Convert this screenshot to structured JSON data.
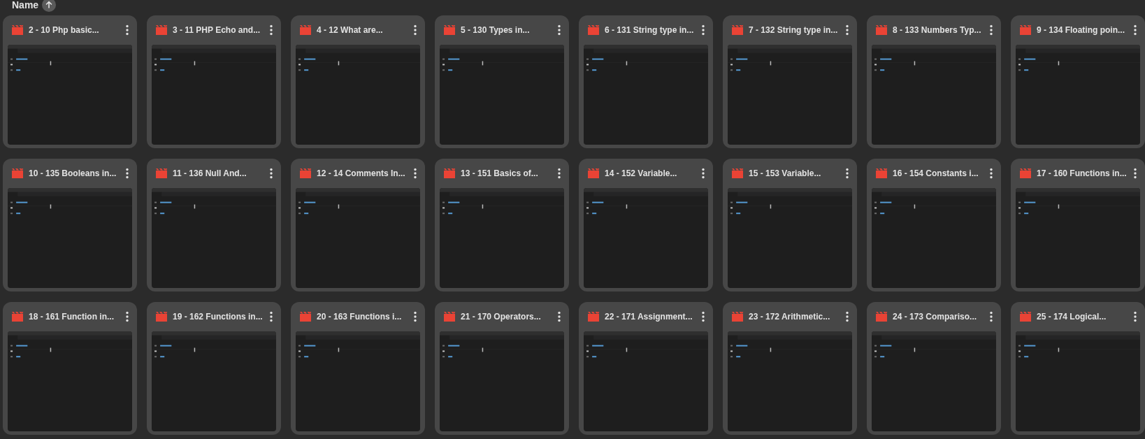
{
  "sort_header": {
    "label": "Name",
    "ascending": true
  },
  "files": [
    {
      "title": "2 - 10 Php basic...",
      "kind": "video"
    },
    {
      "title": "3 - 11 PHP Echo and...",
      "kind": "video"
    },
    {
      "title": "4 - 12 What are...",
      "kind": "video"
    },
    {
      "title": "5 - 130 Types in...",
      "kind": "video"
    },
    {
      "title": "6 - 131 String type in...",
      "kind": "video"
    },
    {
      "title": "7 - 132 String type in...",
      "kind": "video"
    },
    {
      "title": "8 - 133 Numbers Typ...",
      "kind": "video"
    },
    {
      "title": "9 - 134 Floating poin...",
      "kind": "video"
    },
    {
      "title": "10 - 135 Booleans in...",
      "kind": "video"
    },
    {
      "title": "11 - 136 Null And...",
      "kind": "video"
    },
    {
      "title": "12 - 14 Comments In...",
      "kind": "video"
    },
    {
      "title": "13 - 151 Basics of...",
      "kind": "video"
    },
    {
      "title": "14 - 152 Variable...",
      "kind": "video"
    },
    {
      "title": "15 - 153 Variable...",
      "kind": "video"
    },
    {
      "title": "16 - 154 Constants i...",
      "kind": "video"
    },
    {
      "title": "17 - 160 Functions in...",
      "kind": "video"
    },
    {
      "title": "18 - 161 Function in...",
      "kind": "video"
    },
    {
      "title": "19 - 162 Functions in...",
      "kind": "video"
    },
    {
      "title": "20 - 163 Functions i...",
      "kind": "video"
    },
    {
      "title": "21 - 170 Operators...",
      "kind": "video"
    },
    {
      "title": "22 - 171 Assignment...",
      "kind": "video"
    },
    {
      "title": "23 - 172 Arithmetic...",
      "kind": "video"
    },
    {
      "title": "24 - 173 Compariso...",
      "kind": "video"
    },
    {
      "title": "25 - 174 Logical...",
      "kind": "video"
    }
  ]
}
